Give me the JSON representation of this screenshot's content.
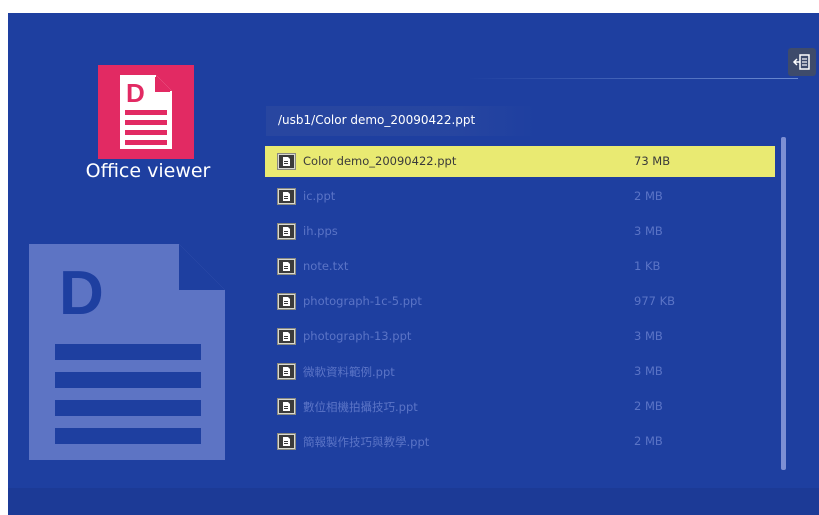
{
  "app": {
    "title": "Office viewer"
  },
  "path": "/usb1/Color demo_20090422.ppt",
  "files": [
    {
      "name": "Color demo_20090422.ppt",
      "size": "73 MB",
      "selected": true
    },
    {
      "name": "ic.ppt",
      "size": "2 MB",
      "selected": false
    },
    {
      "name": "ih.pps",
      "size": "3 MB",
      "selected": false
    },
    {
      "name": "note.txt",
      "size": "1 KB",
      "selected": false
    },
    {
      "name": "photograph-1c-5.ppt",
      "size": "977 KB",
      "selected": false
    },
    {
      "name": "photograph-13.ppt",
      "size": "3 MB",
      "selected": false
    },
    {
      "name": "微軟資料範例.ppt",
      "size": "3 MB",
      "selected": false
    },
    {
      "name": "數位相機拍攝技巧.ppt",
      "size": "2 MB",
      "selected": false
    },
    {
      "name": "簡報製作技巧與教學.ppt",
      "size": "2 MB",
      "selected": false
    }
  ],
  "icons": {
    "app": "office-document-icon",
    "exit": "exit-icon",
    "file": "file-icon"
  },
  "colors": {
    "background": "#1e3fa0",
    "app_icon": "#e22a63",
    "selection": "#e9ea72"
  }
}
